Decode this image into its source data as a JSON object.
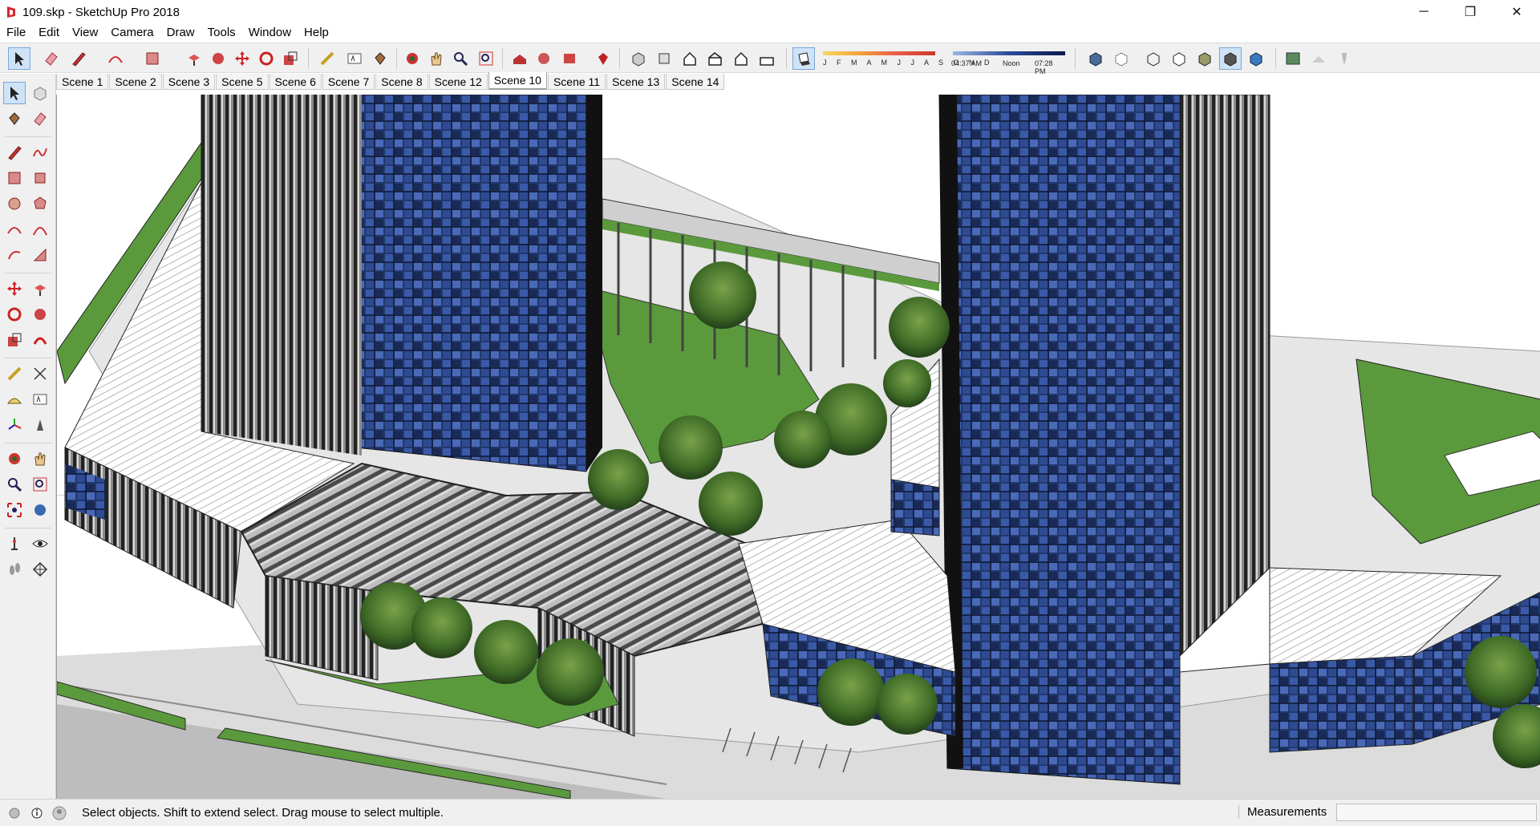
{
  "window": {
    "title": "109.skp - SketchUp Pro 2018",
    "minimize_glyph": "─",
    "restore_glyph": "❐",
    "close_glyph": "✕"
  },
  "menu": {
    "items": [
      "File",
      "Edit",
      "View",
      "Camera",
      "Draw",
      "Tools",
      "Window",
      "Help"
    ]
  },
  "shadow_settings": {
    "months": "J F M A M J J A S O N D",
    "time_start": "04:37 AM",
    "time_mid": "Noon",
    "time_end": "07:28 PM"
  },
  "scenes": {
    "tabs": [
      "Scene 1",
      "Scene 2",
      "Scene 3",
      "Scene 5",
      "Scene 6",
      "Scene 7",
      "Scene 8",
      "Scene 12",
      "Scene 10",
      "Scene 11",
      "Scene 13",
      "Scene 14"
    ],
    "active": "Scene 10"
  },
  "status": {
    "text": "Select objects. Shift to extend select. Drag mouse to select multiple.",
    "measurements_label": "Measurements",
    "measurements_value": ""
  },
  "colors": {
    "glass_blue": "#2c4a8f",
    "grass_green": "#5a9a3c",
    "tree_green": "#4f7a2e"
  }
}
